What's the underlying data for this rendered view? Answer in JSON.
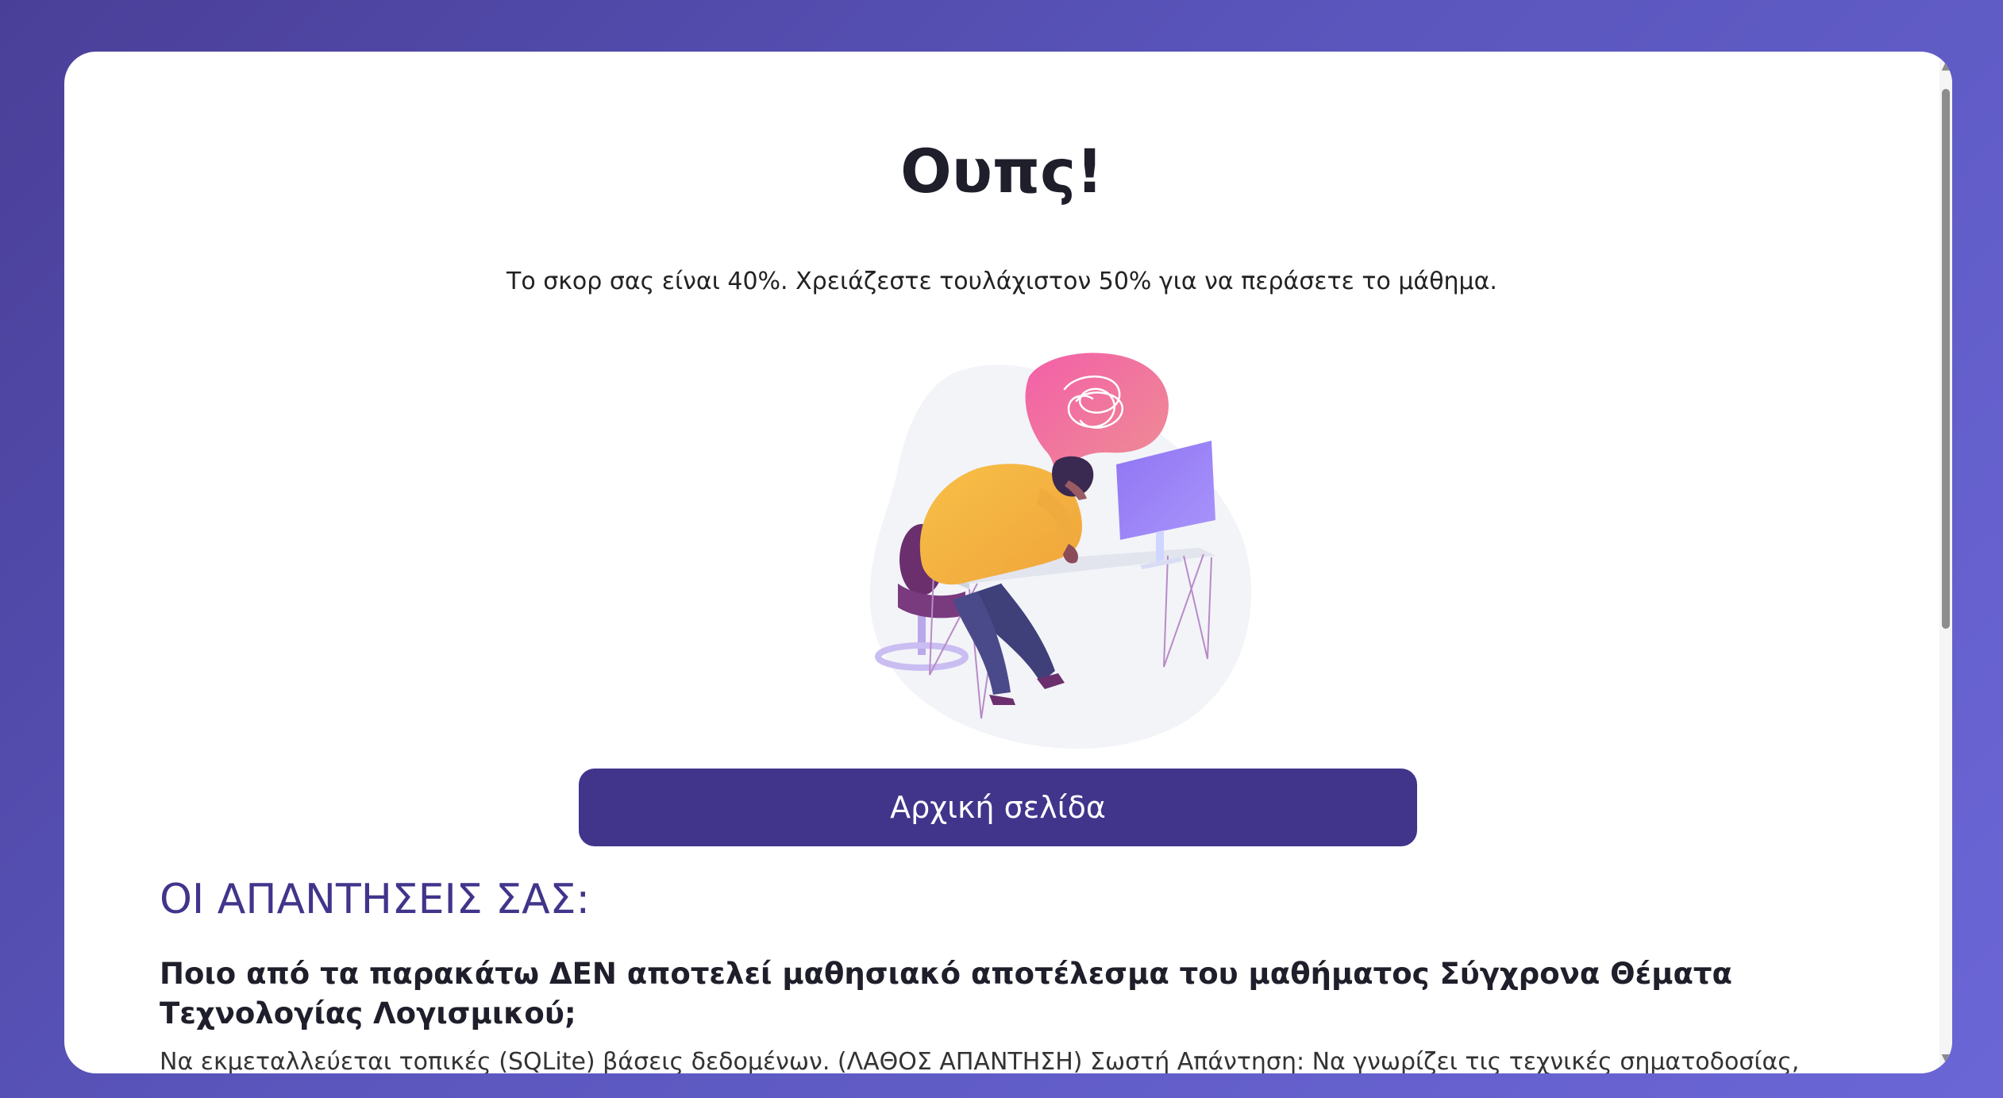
{
  "result": {
    "title": "Ουπς!",
    "message": "Το σκορ σας είναι 40%. Χρειάζεστε τουλάχιστον 50% για να περάσετε το μάθημα.",
    "score_percent": 40,
    "pass_percent": 50
  },
  "actions": {
    "home_label": "Αρχική σελίδα"
  },
  "answers": {
    "heading": "ΟΙ ΑΠΑΝΤΗΣΕΙΣ ΣΑΣ:",
    "items": [
      {
        "question": "Ποιο από τα παρακάτω ΔΕΝ αποτελεί μαθησιακό αποτέλεσμα του μαθήματος Σύγχρονα Θέματα Τεχνολογίας Λογισμικού;",
        "answer": "Να εκμεταλλεύεται τοπικές (SQLite) βάσεις δεδομένων. (ΛΑΘΟΣ ΑΠΑΝΤΗΣΗ) Σωστή Απάντηση: Να γνωρίζει τις τεχνικές σηματοδοσίας,"
      }
    ]
  },
  "illustration": {
    "icon": "frustrated-person-at-computer-illustration",
    "colors": {
      "accent": "#40358b",
      "bubble": "#ef6fa5",
      "shirt": "#f6b73c",
      "monitor": "#8e7bf2"
    }
  }
}
